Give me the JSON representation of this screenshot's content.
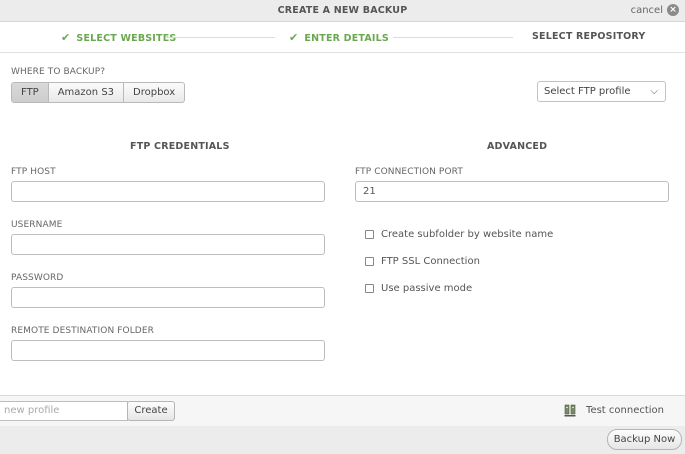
{
  "dialog": {
    "title": "CREATE A NEW BACKUP",
    "cancel_label": "cancel"
  },
  "steps": [
    {
      "label": "SELECT WEBSITES",
      "state": "done"
    },
    {
      "label": "ENTER DETAILS",
      "state": "done"
    },
    {
      "label": "SELECT REPOSITORY",
      "state": "active"
    }
  ],
  "destination": {
    "label": "WHERE TO BACKUP?",
    "options": [
      "FTP",
      "Amazon S3",
      "Dropbox"
    ],
    "selected": "FTP",
    "profile_select": "Select FTP profile"
  },
  "credentials": {
    "title": "FTP CREDENTIALS",
    "host_label": "FTP HOST",
    "host_value": "",
    "username_label": "USERNAME",
    "username_value": "",
    "password_label": "PASSWORD",
    "password_value": "",
    "folder_label": "REMOTE DESTINATION FOLDER",
    "folder_value": ""
  },
  "advanced": {
    "title": "ADVANCED",
    "port_label": "FTP CONNECTION PORT",
    "port_value": "21",
    "options": [
      {
        "label": "Create subfolder by website name",
        "checked": false
      },
      {
        "label": "FTP SSL Connection",
        "checked": false
      },
      {
        "label": "Use passive mode",
        "checked": false
      }
    ]
  },
  "profile": {
    "placeholder": "new profile",
    "create_label": "Create",
    "test_label": "Test connection"
  },
  "footer": {
    "backup_label": "Backup Now"
  },
  "colors": {
    "done_step": "#6aa84f",
    "header_bg": "#ececec"
  }
}
